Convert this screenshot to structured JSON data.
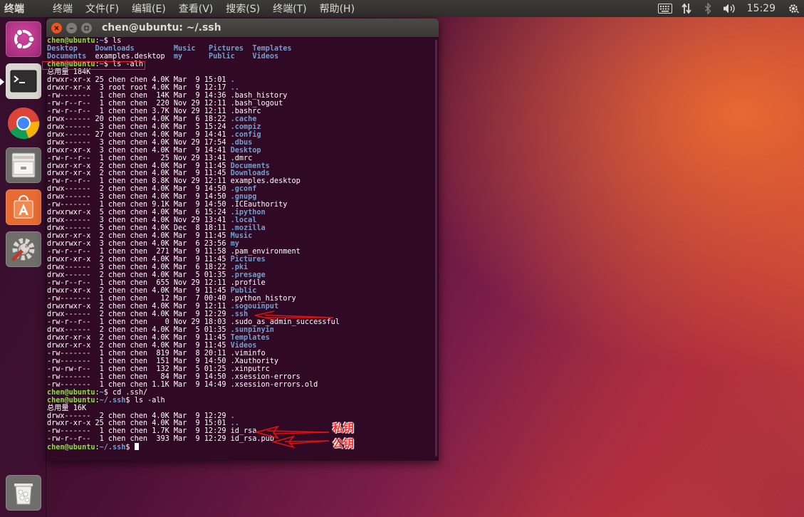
{
  "top_panel": {
    "app_title": "终端",
    "menus": [
      "终端",
      "文件(F)",
      "编辑(E)",
      "查看(V)",
      "搜索(S)",
      "终端(T)",
      "帮助(H)"
    ],
    "clock": "15:29",
    "indicators": [
      "keyboard-icon",
      "network-icon",
      "bluetooth-icon",
      "volume-icon",
      "settings-gear-icon"
    ]
  },
  "launcher": {
    "items": [
      "ubuntu-dash-icon",
      "terminal-icon",
      "chrome-icon",
      "files-icon",
      "software-center-icon",
      "system-settings-icon",
      "trash-icon"
    ]
  },
  "terminal": {
    "title": "chen@ubuntu: ~/.ssh",
    "lines": [
      [
        [
          "p",
          "chen@ubuntu"
        ],
        [
          "t",
          ":"
        ],
        [
          "pp",
          "~"
        ],
        [
          "t",
          "$ ls"
        ]
      ],
      [
        [
          "d",
          "Desktop"
        ],
        [
          "t",
          "    "
        ],
        [
          "d",
          "Downloads"
        ],
        [
          "t",
          "         "
        ],
        [
          "d",
          "Music"
        ],
        [
          "t",
          "   "
        ],
        [
          "d",
          "Pictures"
        ],
        [
          "t",
          "  "
        ],
        [
          "d",
          "Templates"
        ]
      ],
      [
        [
          "d",
          "Documents"
        ],
        [
          "t",
          "  examples.desktop  "
        ],
        [
          "d",
          "my"
        ],
        [
          "t",
          "      "
        ],
        [
          "d",
          "Public"
        ],
        [
          "t",
          "    "
        ],
        [
          "d",
          "Videos"
        ]
      ],
      [
        [
          "p",
          "chen@ubuntu"
        ],
        [
          "t",
          ":"
        ],
        [
          "pp",
          "~"
        ],
        [
          "t",
          "$ ls -alh"
        ]
      ],
      [
        [
          "t",
          "总用量 184K"
        ]
      ],
      [
        [
          "t",
          "drwxr-xr-x 25 chen chen 4.0K Mar  9 15:01 "
        ],
        [
          "d",
          "."
        ]
      ],
      [
        [
          "t",
          "drwxr-xr-x  3 root root 4.0K Mar  9 12:17 "
        ],
        [
          "d",
          ".."
        ]
      ],
      [
        [
          "t",
          "-rw-------  1 chen chen  14K Mar  9 14:36 .bash_history"
        ]
      ],
      [
        [
          "t",
          "-rw-r--r--  1 chen chen  220 Nov 29 12:11 .bash_logout"
        ]
      ],
      [
        [
          "t",
          "-rw-r--r--  1 chen chen 3.7K Nov 29 12:11 .bashrc"
        ]
      ],
      [
        [
          "t",
          "drwx------ 20 chen chen 4.0K Mar  6 18:22 "
        ],
        [
          "d",
          ".cache"
        ]
      ],
      [
        [
          "t",
          "drwx------  3 chen chen 4.0K Mar  5 15:24 "
        ],
        [
          "d",
          ".compiz"
        ]
      ],
      [
        [
          "t",
          "drwx------ 27 chen chen 4.0K Mar  9 14:41 "
        ],
        [
          "d",
          ".config"
        ]
      ],
      [
        [
          "t",
          "drwx------  3 chen chen 4.0K Nov 29 17:54 "
        ],
        [
          "d",
          ".dbus"
        ]
      ],
      [
        [
          "t",
          "drwxr-xr-x  3 chen chen 4.0K Mar  9 14:41 "
        ],
        [
          "d",
          "Desktop"
        ]
      ],
      [
        [
          "t",
          "-rw-r--r--  1 chen chen   25 Nov 29 13:41 .dmrc"
        ]
      ],
      [
        [
          "t",
          "drwxr-xr-x  2 chen chen 4.0K Mar  9 11:45 "
        ],
        [
          "d",
          "Documents"
        ]
      ],
      [
        [
          "t",
          "drwxr-xr-x  2 chen chen 4.0K Mar  9 11:45 "
        ],
        [
          "d",
          "Downloads"
        ]
      ],
      [
        [
          "t",
          "-rw-r--r--  1 chen chen 8.8K Nov 29 12:11 examples.desktop"
        ]
      ],
      [
        [
          "t",
          "drwx------  2 chen chen 4.0K Mar  9 14:50 "
        ],
        [
          "d",
          ".gconf"
        ]
      ],
      [
        [
          "t",
          "drwx------  3 chen chen 4.0K Mar  9 14:50 "
        ],
        [
          "d",
          ".gnupg"
        ]
      ],
      [
        [
          "t",
          "-rw-------  1 chen chen 9.1K Mar  9 14:50 .ICEauthority"
        ]
      ],
      [
        [
          "t",
          "drwxrwxr-x  5 chen chen 4.0K Mar  6 15:24 "
        ],
        [
          "d",
          ".ipython"
        ]
      ],
      [
        [
          "t",
          "drwx------  3 chen chen 4.0K Nov 29 13:41 "
        ],
        [
          "d",
          ".local"
        ]
      ],
      [
        [
          "t",
          "drwx------  5 chen chen 4.0K Dec  8 18:11 "
        ],
        [
          "d",
          ".mozilla"
        ]
      ],
      [
        [
          "t",
          "drwxr-xr-x  2 chen chen 4.0K Mar  9 11:45 "
        ],
        [
          "d",
          "Music"
        ]
      ],
      [
        [
          "t",
          "drwxrwxr-x  3 chen chen 4.0K Mar  6 23:56 "
        ],
        [
          "d",
          "my"
        ]
      ],
      [
        [
          "t",
          "-rw-r--r--  1 chen chen  271 Mar  9 11:58 .pam_environment"
        ]
      ],
      [
        [
          "t",
          "drwxr-xr-x  2 chen chen 4.0K Mar  9 11:45 "
        ],
        [
          "d",
          "Pictures"
        ]
      ],
      [
        [
          "t",
          "drwx------  3 chen chen 4.0K Mar  6 18:22 "
        ],
        [
          "d",
          ".pki"
        ]
      ],
      [
        [
          "t",
          "drwx------  2 chen chen 4.0K Mar  5 01:35 "
        ],
        [
          "d",
          ".presage"
        ]
      ],
      [
        [
          "t",
          "-rw-r--r--  1 chen chen  655 Nov 29 12:11 .profile"
        ]
      ],
      [
        [
          "t",
          "drwxr-xr-x  2 chen chen 4.0K Mar  9 11:45 "
        ],
        [
          "d",
          "Public"
        ]
      ],
      [
        [
          "t",
          "-rw-------  1 chen chen   12 Mar  7 00:40 .python_history"
        ]
      ],
      [
        [
          "t",
          "drwxrwxr-x  2 chen chen 4.0K Mar  9 12:11 "
        ],
        [
          "d",
          ".sogouinput"
        ]
      ],
      [
        [
          "t",
          "drwx------  2 chen chen 4.0K Mar  9 12:29 "
        ],
        [
          "d",
          ".ssh"
        ]
      ],
      [
        [
          "t",
          "-rw-r--r--  1 chen chen    0 Nov 29 18:03 .sudo_as_admin_successful"
        ]
      ],
      [
        [
          "t",
          "drwx------  2 chen chen 4.0K Mar  5 01:35 "
        ],
        [
          "d",
          ".sunpinyin"
        ]
      ],
      [
        [
          "t",
          "drwxr-xr-x  2 chen chen 4.0K Mar  9 11:45 "
        ],
        [
          "d",
          "Templates"
        ]
      ],
      [
        [
          "t",
          "drwxr-xr-x  2 chen chen 4.0K Mar  9 11:45 "
        ],
        [
          "d",
          "Videos"
        ]
      ],
      [
        [
          "t",
          "-rw-------  1 chen chen  819 Mar  8 20:11 .viminfo"
        ]
      ],
      [
        [
          "t",
          "-rw-------  1 chen chen  151 Mar  9 14:50 .Xauthority"
        ]
      ],
      [
        [
          "t",
          "-rw-rw-r--  1 chen chen  132 Mar  5 01:25 .xinputrc"
        ]
      ],
      [
        [
          "t",
          "-rw-------  1 chen chen   84 Mar  9 14:50 .xsession-errors"
        ]
      ],
      [
        [
          "t",
          "-rw-------  1 chen chen 1.1K Mar  9 14:49 .xsession-errors.old"
        ]
      ],
      [
        [
          "p",
          "chen@ubuntu"
        ],
        [
          "t",
          ":"
        ],
        [
          "pp",
          "~"
        ],
        [
          "t",
          "$ cd .ssh/"
        ]
      ],
      [
        [
          "p",
          "chen@ubuntu"
        ],
        [
          "t",
          ":"
        ],
        [
          "pp",
          "~/.ssh"
        ],
        [
          "t",
          "$ ls -alh"
        ]
      ],
      [
        [
          "t",
          "总用量 16K"
        ]
      ],
      [
        [
          "t",
          "drwx------  2 chen chen 4.0K Mar  9 12:29 "
        ],
        [
          "d",
          "."
        ]
      ],
      [
        [
          "t",
          "drwxr-xr-x 25 chen chen 4.0K Mar  9 15:01 "
        ],
        [
          "d",
          ".."
        ]
      ],
      [
        [
          "t",
          "-rw-------  1 chen chen 1.7K Mar  9 12:29 id_rsa"
        ]
      ],
      [
        [
          "t",
          "-rw-r--r--  1 chen chen  393 Mar  9 12:29 id_rsa.pub"
        ]
      ],
      [
        [
          "p",
          "chen@ubuntu"
        ],
        [
          "t",
          ":"
        ],
        [
          "pp",
          "~/.ssh"
        ],
        [
          "t",
          "$ "
        ],
        [
          "cursor",
          ""
        ]
      ]
    ]
  },
  "annotations": {
    "private_key_label": "私钥",
    "public_key_label": "公钥"
  }
}
